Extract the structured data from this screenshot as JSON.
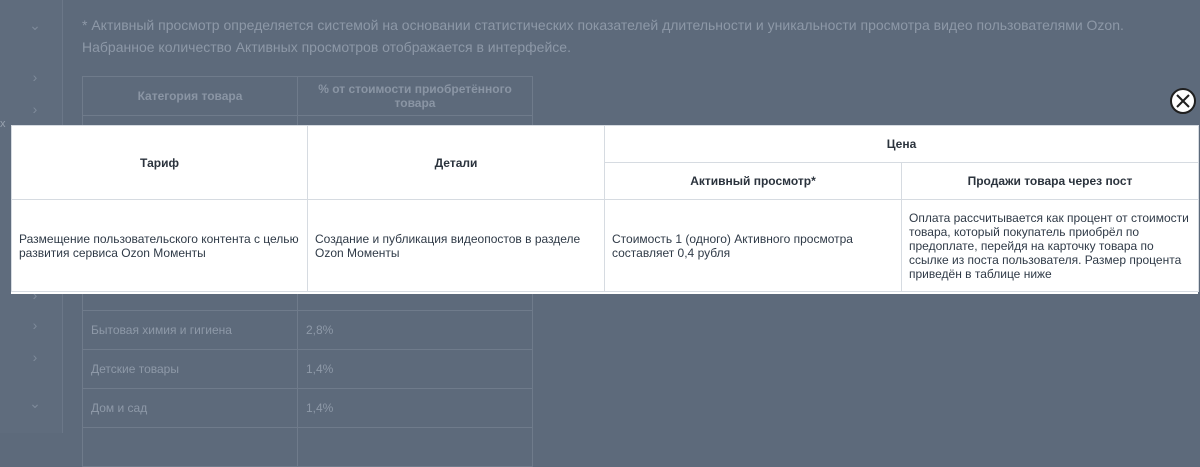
{
  "background": {
    "note_line1": "* Активный просмотр определяется системой на основании статистических показателей длительности и уникальности просмотра видео пользователями Ozon.",
    "note_line2": "Набранное количество Активных просмотров отображается в интерфейсе.",
    "table_headers": [
      "Категория товара",
      "% от стоимости приобретённого товара"
    ],
    "rows": [
      {
        "category": "Бытовая химия и гигиена",
        "percent": "2,8%"
      },
      {
        "category": "Детские товары",
        "percent": "1,4%"
      },
      {
        "category": "Дом и сад",
        "percent": "1,4%"
      }
    ],
    "edge_label": "x"
  },
  "modal": {
    "headers": {
      "tariff": "Тариф",
      "details": "Детали",
      "price": "Цена",
      "active_view": "Активный просмотр*",
      "post_sales": "Продажи товара через пост"
    },
    "row": {
      "tariff": "Размещение пользовательского контента с целью развития сервиса Ozon Моменты",
      "details": "Создание и публикация видеопостов в разделе Ozon Моменты",
      "active_view": "Стоимость 1 (одного) Активного просмотра составляет 0,4 рубля",
      "post_sales": "Оплата рассчитывается как процент от стоимости товара, который покупатель приобрёл по предоплате, перейдя на карточку товара по ссылке из поста пользователя. Размер процента приведён в таблице ниже"
    }
  },
  "icons": {
    "close": "close-icon",
    "sidebar_expand": "chevron-right-icon",
    "sidebar_collapse": "chevron-down-icon"
  }
}
